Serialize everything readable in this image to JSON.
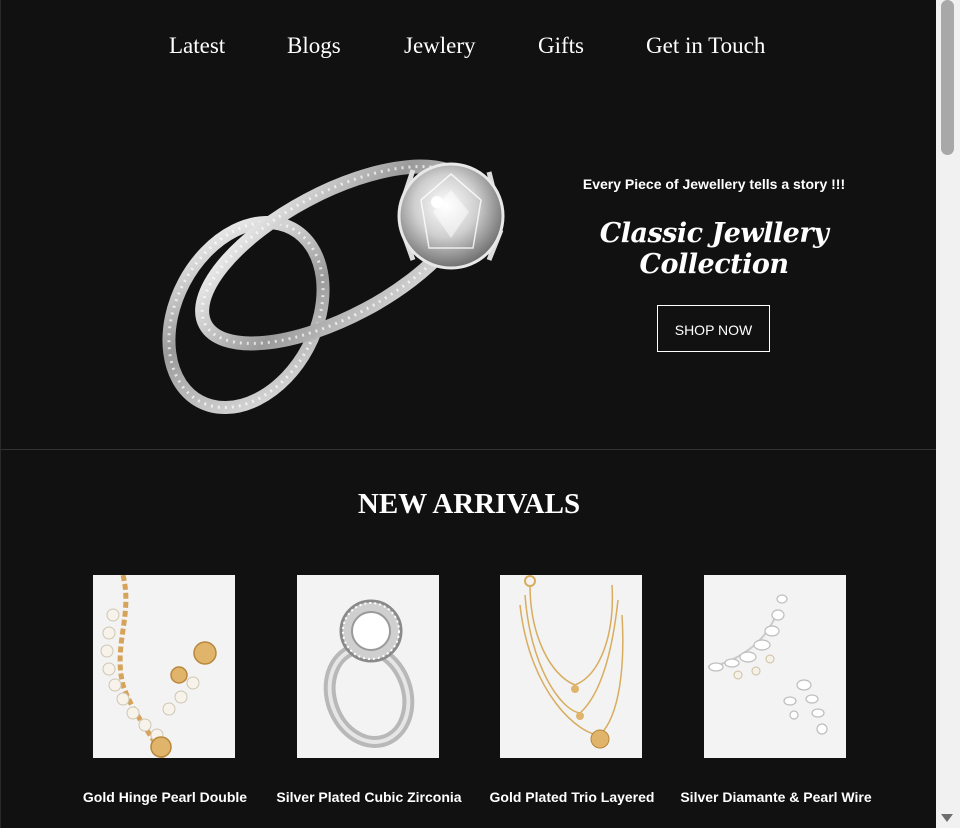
{
  "nav": {
    "items": [
      {
        "label": "Latest"
      },
      {
        "label": "Blogs"
      },
      {
        "label": "Jewlery"
      },
      {
        "label": "Gifts"
      },
      {
        "label": "Get in Touch"
      }
    ]
  },
  "hero": {
    "image_icon": "diamond-ring-set-icon",
    "tagline": "Every Piece of Jewellery tells a story !!!",
    "collection_title": "Classic Jewllery Collection",
    "cta_label": "SHOP NOW"
  },
  "arrivals": {
    "title": "NEW ARRIVALS",
    "products": [
      {
        "name": "Gold Hinge Pearl Double",
        "image_icon": "pearl-coin-necklace-icon"
      },
      {
        "name": "Silver Plated Cubic Zirconia",
        "image_icon": "halo-ring-icon"
      },
      {
        "name": "Gold Plated Trio Layered",
        "image_icon": "layered-necklace-icon"
      },
      {
        "name": "Silver Diamante & Pearl Wire",
        "image_icon": "diamante-pearl-set-icon"
      }
    ]
  },
  "colors": {
    "background": "#111111",
    "text": "#ffffff",
    "product_bg": "#f3f3f3"
  }
}
